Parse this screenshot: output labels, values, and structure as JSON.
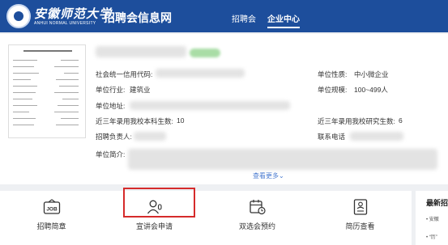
{
  "header": {
    "school_cn": "安徽师范大学",
    "school_en": "ANHUI NORMAL UNIVERSITY",
    "site_title": "招聘会信息网",
    "nav": [
      "招聘会",
      "企业中心"
    ]
  },
  "company": {
    "credit_code_label": "社会统一信用代码:",
    "industry_label": "单位行业:",
    "industry_value": "建筑业",
    "address_label": "单位地址:",
    "undergrad_label": "近三年录用我校本科生数:",
    "undergrad_value": "10",
    "recruiter_label": "招聘负责人:",
    "intro_label": "单位简介:",
    "nature_label": "单位性质:",
    "nature_value": "中小微企业",
    "scale_label": "单位规模:",
    "scale_value": "100~499人",
    "grad_label": "近三年录用我校研究生数:",
    "grad_value": "6",
    "phone_label": "联系电话",
    "more": "查看更多"
  },
  "tabs": [
    {
      "label": "招聘简章",
      "icon": "job-board-icon"
    },
    {
      "label": "宣讲会申请",
      "icon": "speaker-icon"
    },
    {
      "label": "双选会预约",
      "icon": "calendar-clock-icon"
    },
    {
      "label": "简历查看",
      "icon": "resume-icon"
    }
  ],
  "sidebar": {
    "title": "最新招",
    "items": [
      "安徽",
      "“历”"
    ]
  },
  "colors": {
    "header_bg": "#1d4e9c",
    "highlight": "#d52b2b",
    "link": "#4a7bd0"
  }
}
